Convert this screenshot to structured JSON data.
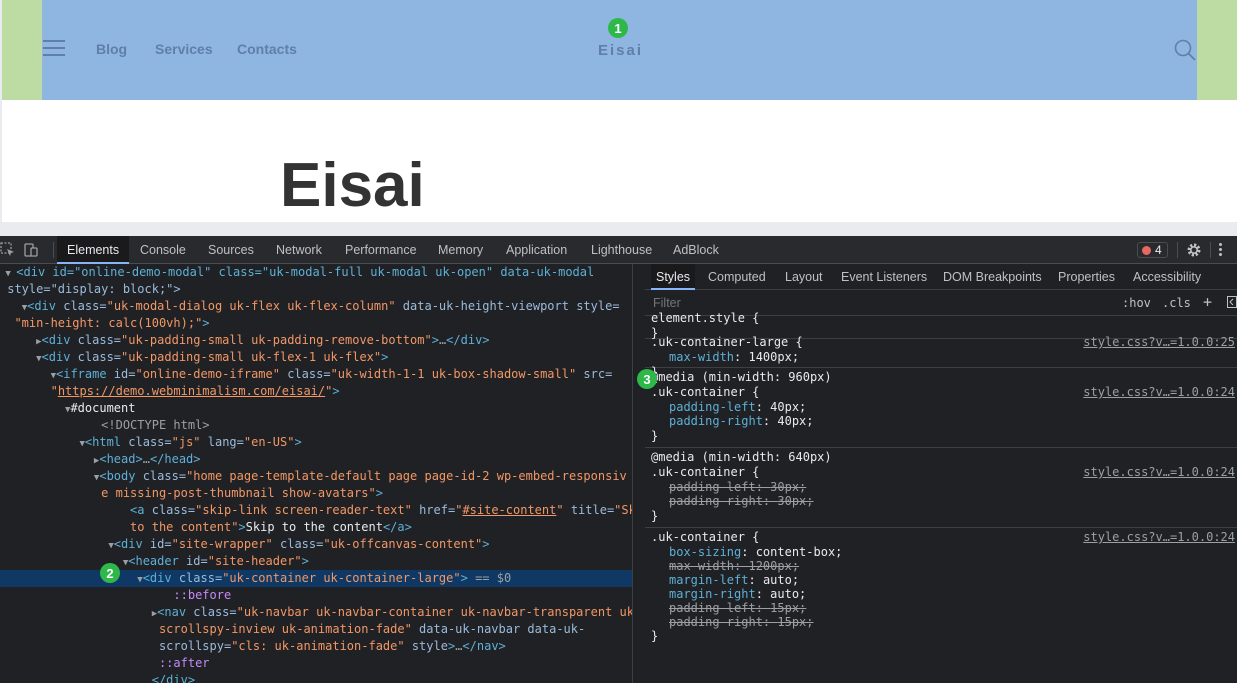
{
  "site": {
    "nav_links": [
      "Blog",
      "Services",
      "Contacts"
    ],
    "logo": "Eisai",
    "heading": "Eisai",
    "colors": {
      "header_container": "#8fb6e1",
      "header_padding": "#bcdca4"
    }
  },
  "badges": [
    "1",
    "2",
    "3"
  ],
  "devtools": {
    "tabs": [
      "Elements",
      "Console",
      "Sources",
      "Network",
      "Performance",
      "Memory",
      "Application",
      "Lighthouse",
      "AdBlock"
    ],
    "active_tab": "Elements",
    "error_count": "4",
    "dom": {
      "l1a": "<div id=\"online-demo-modal\" class=\"uk-modal-full uk-modal uk-open\" data-uk-modal",
      "l1b": "style=\"display: block;\">",
      "iframe_src": "https://demo.webminimalism.com/eisai/",
      "document": "#document",
      "doctype": "<!DOCTYPE html>",
      "before": "::before",
      "after": "::after",
      "selected_suffix": "== $0"
    },
    "styles": {
      "tabs": [
        "Styles",
        "Computed",
        "Layout",
        "Event Listeners",
        "DOM Breakpoints",
        "Properties",
        "Accessibility"
      ],
      "filter_placeholder": "Filter",
      "hov": ":hov",
      "cls": ".cls",
      "rules": [
        {
          "media": "",
          "selector": "element.style {",
          "source": "",
          "props": []
        },
        {
          "media": "",
          "selector": ".uk-container-large {",
          "source": "style.css?v…=1.0.0:25",
          "props": [
            {
              "name": "max-width",
              "value": "1400px;",
              "struck": false
            }
          ]
        },
        {
          "media": "@media (min-width: 960px)",
          "selector": ".uk-container {",
          "source": "style.css?v…=1.0.0:24",
          "props": [
            {
              "name": "padding-left",
              "value": "40px;",
              "struck": false
            },
            {
              "name": "padding-right",
              "value": "40px;",
              "struck": false
            }
          ]
        },
        {
          "media": "@media (min-width: 640px)",
          "selector": ".uk-container {",
          "source": "style.css?v…=1.0.0:24",
          "props": [
            {
              "name": "padding-left",
              "value": "30px;",
              "struck": true
            },
            {
              "name": "padding-right",
              "value": "30px;",
              "struck": true
            }
          ]
        },
        {
          "media": "",
          "selector": ".uk-container {",
          "source": "style.css?v…=1.0.0:24",
          "props": [
            {
              "name": "box-sizing",
              "value": "content-box;",
              "struck": false
            },
            {
              "name": "max-width",
              "value": "1200px;",
              "struck": true
            },
            {
              "name": "margin-left",
              "value": "auto;",
              "struck": false
            },
            {
              "name": "margin-right",
              "value": "auto;",
              "struck": false
            },
            {
              "name": "padding-left",
              "value": "15px;",
              "struck": true
            },
            {
              "name": "padding-right",
              "value": "15px;",
              "struck": true
            }
          ]
        }
      ]
    }
  }
}
